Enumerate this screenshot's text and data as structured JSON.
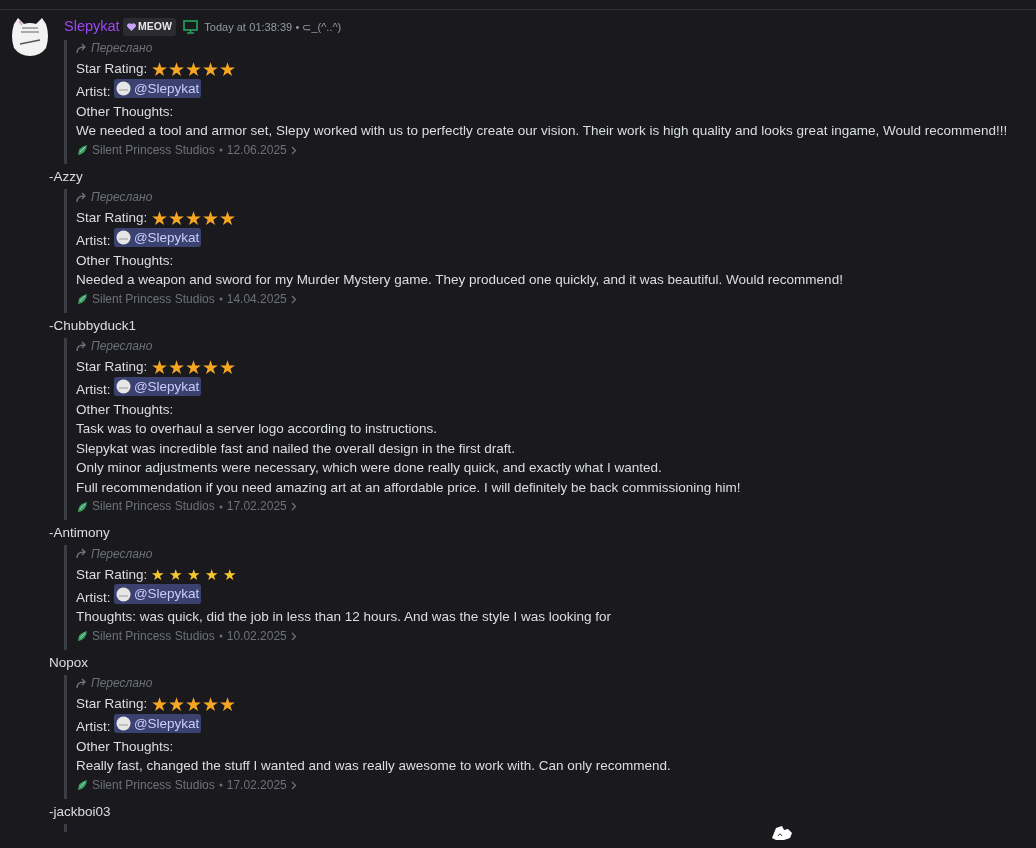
{
  "author": {
    "name": "Slepykat",
    "badge": "MEOW",
    "timestamp_label": "Today at",
    "time": "01:38:39",
    "status": "• ⊂_(^..^)"
  },
  "forwards": [
    {
      "forwarded_label": "Переслано",
      "rating_label": "Star Rating:",
      "stars": 5,
      "kind": "emoji",
      "artist_label": "Artist:",
      "mention": "@Slepykat",
      "lines": [
        "Other Thoughts:",
        "We needed a tool and armor set, Slepy worked with us to perfectly create our vision. Their work is high quality and looks great ingame, Would recommend!!!"
      ],
      "source": "Silent Princess Studios",
      "date": "12.06.2025",
      "signature": "-Azzy"
    },
    {
      "forwarded_label": "Переслано",
      "rating_label": "Star Rating:",
      "stars": 5,
      "kind": "emoji",
      "artist_label": "Artist:",
      "mention": "@Slepykat",
      "lines": [
        "Other Thoughts:",
        "Needed a weapon and sword for my Murder Mystery game. They produced one quickly, and it was beautiful. Would recommend!"
      ],
      "source": "Silent Princess Studios",
      "date": "14.04.2025",
      "signature": "-Chubbyduck1"
    },
    {
      "forwarded_label": "Переслано",
      "rating_label": "Star Rating:",
      "stars": 5,
      "kind": "emoji",
      "artist_label": "Artist:",
      "mention": "@Slepykat",
      "lines": [
        "Other Thoughts:",
        "Task was to overhaul a server logo according to instructions.",
        "Slepykat was incredible fast and nailed the overall design in the first draft.",
        "Only minor adjustments were necessary, which were done really quick, and exactly what I wanted.",
        "Full recommendation if you need amazing art at an affordable price. I will definitely be back commissioning him!"
      ],
      "source": "Silent Princess Studios",
      "date": "17.02.2025",
      "signature": "-Antimony"
    },
    {
      "forwarded_label": "Переслано",
      "rating_label": "Star Rating:",
      "stars": 5,
      "kind": "small",
      "artist_label": "Artist:",
      "mention": "@Slepykat",
      "lines": [
        "Thoughts: was quick, did the job in less than 12 hours. And was the style I was looking for"
      ],
      "source": "Silent Princess Studios",
      "date": "10.02.2025",
      "signature": "Nopox"
    },
    {
      "forwarded_label": "Переслано",
      "rating_label": "Star Rating:",
      "stars": 5,
      "kind": "emoji",
      "artist_label": "Artist:",
      "mention": "@Slepykat",
      "lines": [
        "Other Thoughts:",
        "Really fast, changed the stuff I wanted and was really awesome to work with. Can only recommend."
      ],
      "source": "Silent Princess Studios",
      "date": "17.02.2025",
      "signature": "-jackboi03"
    }
  ]
}
